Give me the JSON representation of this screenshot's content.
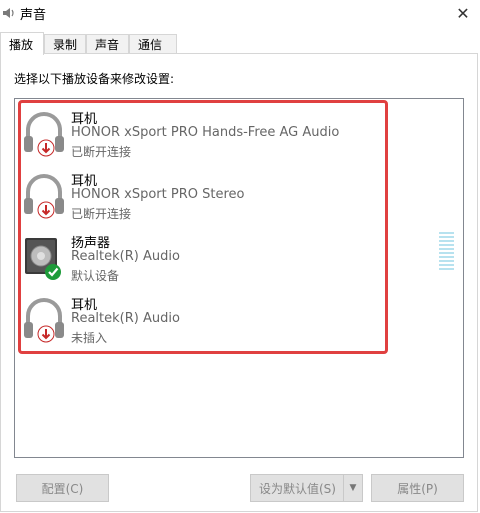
{
  "window": {
    "title": "声音"
  },
  "tabs": [
    {
      "label": "播放"
    },
    {
      "label": "录制"
    },
    {
      "label": "声音"
    },
    {
      "label": "通信"
    }
  ],
  "instruction": "选择以下播放设备来修改设置:",
  "devices": [
    {
      "name": "耳机",
      "description": "HONOR xSport PRO Hands-Free AG Audio",
      "status": "已断开连接",
      "icon": "headphones-icon",
      "badge": "disconnected-arrow-icon"
    },
    {
      "name": "耳机",
      "description": "HONOR xSport PRO Stereo",
      "status": "已断开连接",
      "icon": "headphones-icon",
      "badge": "disconnected-arrow-icon"
    },
    {
      "name": "扬声器",
      "description": "Realtek(R) Audio",
      "status": "默认设备",
      "icon": "speaker-icon",
      "badge": "default-check-icon"
    },
    {
      "name": "耳机",
      "description": "Realtek(R) Audio",
      "status": "未插入",
      "icon": "headphones-icon",
      "badge": "unplugged-arrow-icon"
    }
  ],
  "buttons": {
    "configure": "配置(C)",
    "set_default": "设为默认值(S)",
    "properties": "属性(P)"
  },
  "colors": {
    "highlight": "#e04040",
    "badge_red": "#c62828",
    "badge_green": "#1e9b3a",
    "meter": "#b7e2ef"
  }
}
